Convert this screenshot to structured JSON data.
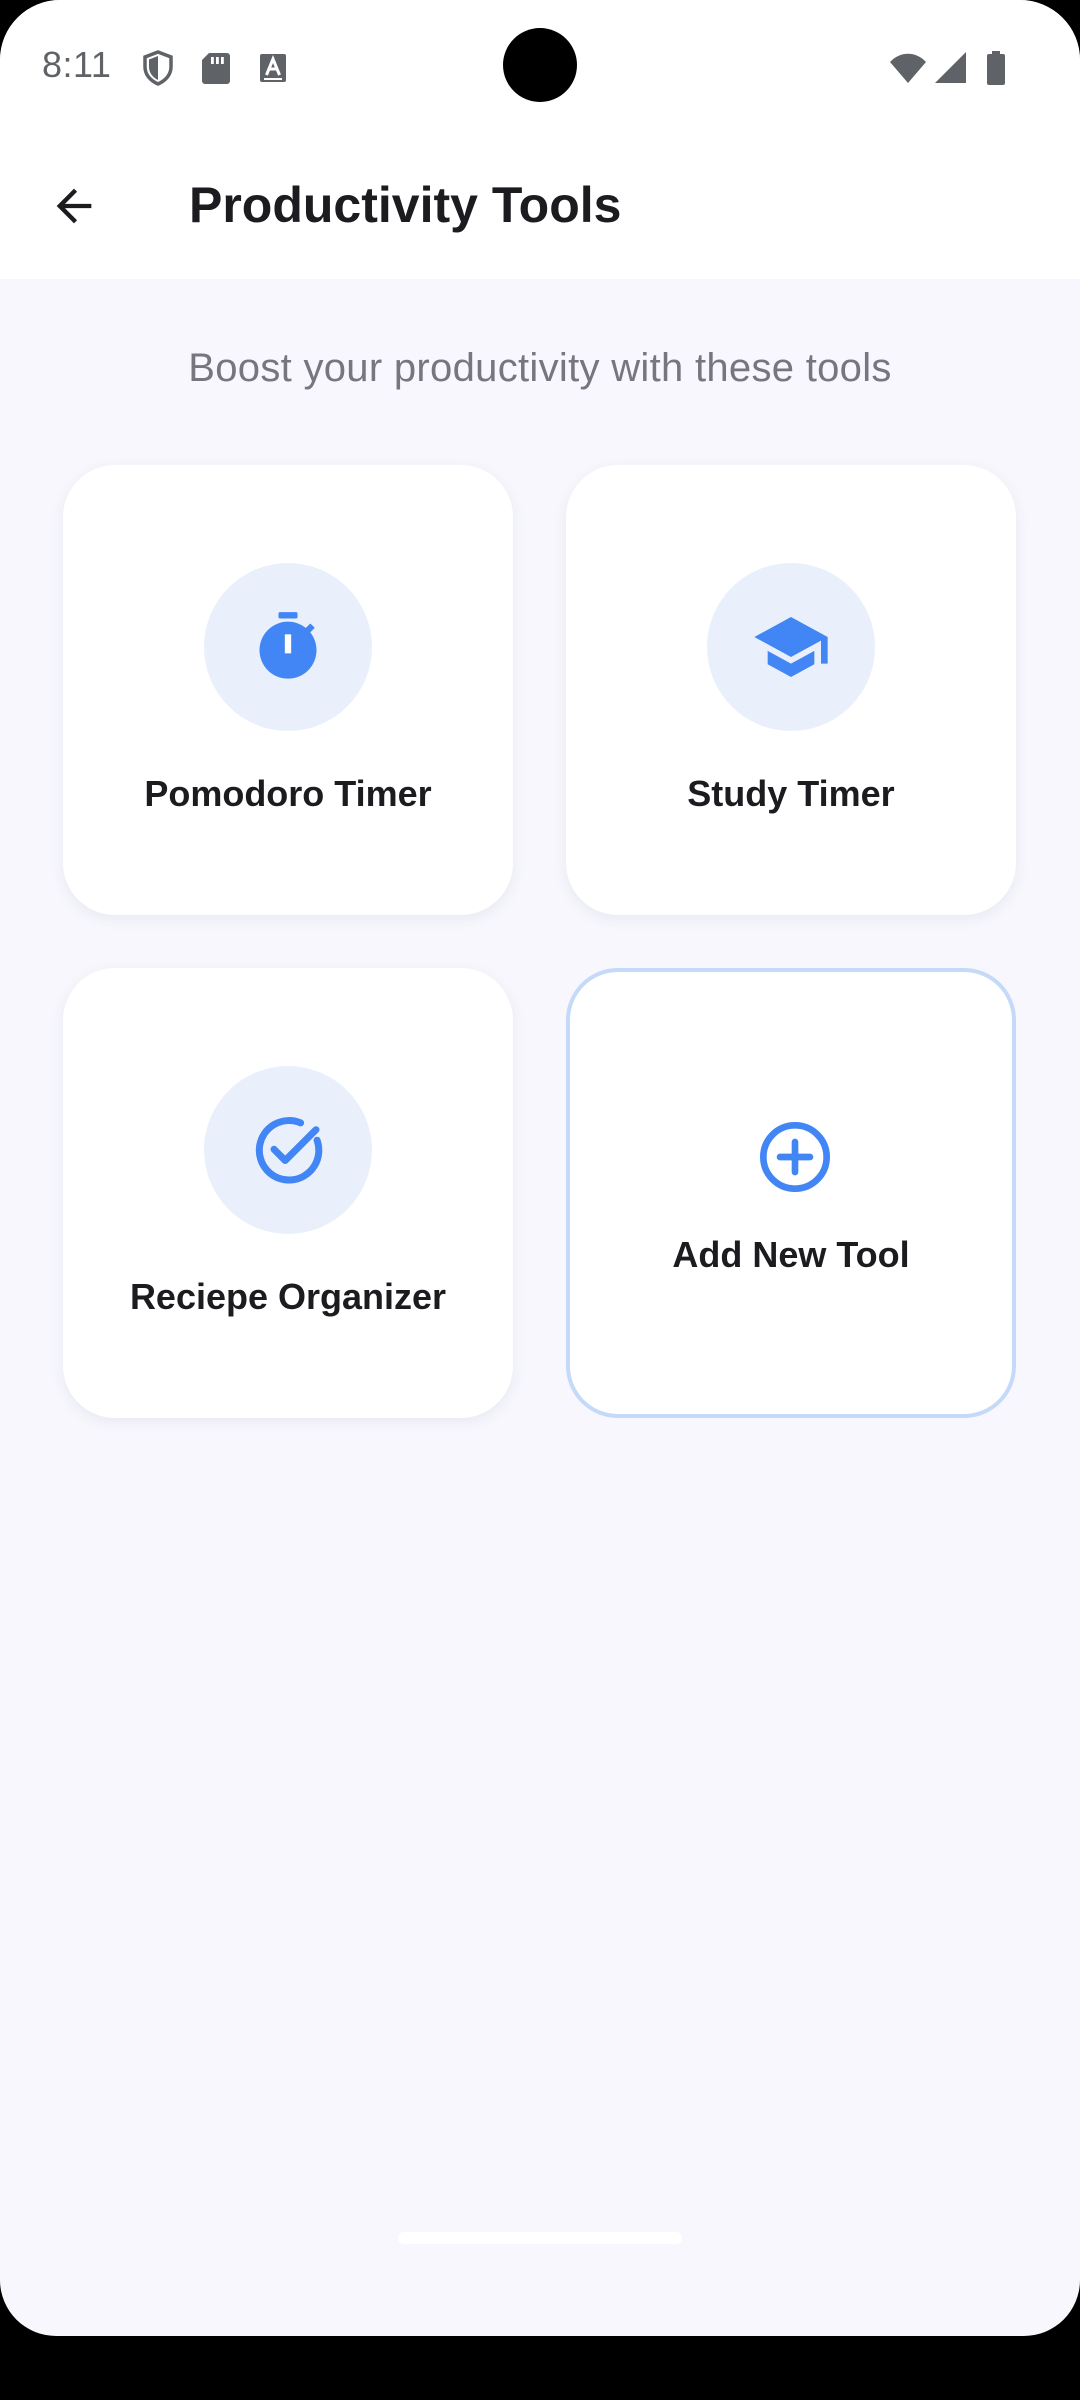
{
  "status_bar": {
    "time": "8:11",
    "left_icons": [
      "shield-icon",
      "sd-card-icon",
      "keyboard-a-icon"
    ],
    "right_icons": [
      "wifi-icon",
      "cell-signal-icon",
      "battery-icon"
    ]
  },
  "app_bar": {
    "back_icon": "arrow-back-icon",
    "title": "Productivity Tools"
  },
  "main": {
    "subtitle": "Boost your productivity with these tools",
    "tools": [
      {
        "label": "Pomodoro Timer",
        "icon": "timer-icon"
      },
      {
        "label": "Study Timer",
        "icon": "graduation-cap-icon"
      },
      {
        "label": "Reciepe Organizer",
        "icon": "check-circle-icon"
      }
    ],
    "add_tool": {
      "label": "Add New Tool",
      "icon": "add-circle-icon"
    }
  },
  "colors": {
    "accent": "#4285F4",
    "icon_bg": "#E9F0FC",
    "page_bg": "#F7F7FD",
    "add_border": "#C5D9F8"
  }
}
